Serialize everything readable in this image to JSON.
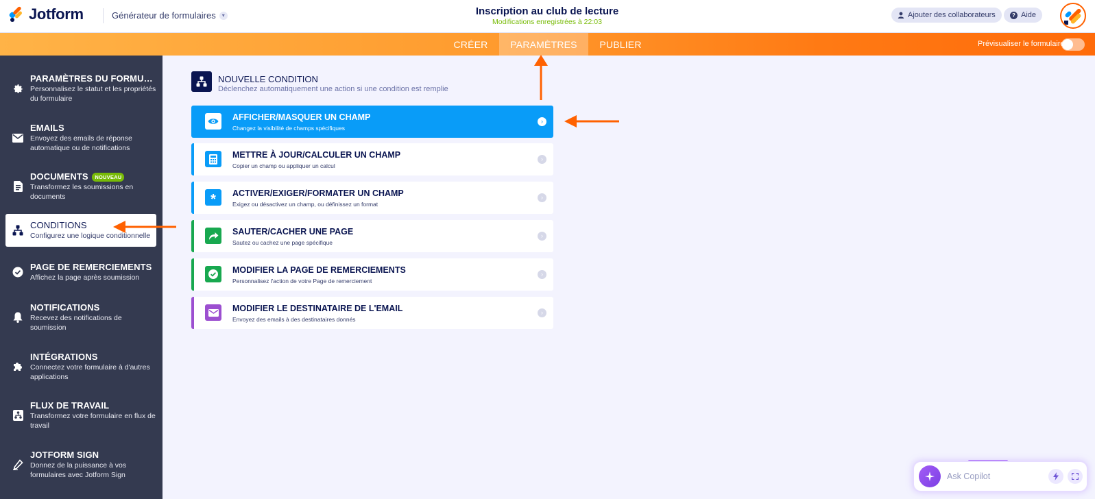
{
  "header": {
    "logo_text": "Jotform",
    "builder_label": "Générateur de formulaires",
    "form_title": "Inscription au club de lecture",
    "saved_status": "Modifications enregistrées à 22:03",
    "collaborators_label": "Ajouter des collaborateurs",
    "help_label": "Aide"
  },
  "navbar": {
    "tabs": [
      {
        "label": "CRÉER",
        "active": false
      },
      {
        "label": "PARAMÈTRES",
        "active": true
      },
      {
        "label": "PUBLIER",
        "active": false
      }
    ],
    "preview_label": "Prévisualiser le formulaire",
    "preview_enabled": false
  },
  "sidebar": {
    "items": [
      {
        "title": "PARAMÈTRES DU FORMULAIRE",
        "desc": "Personnalisez le statut et les propriétés du formulaire",
        "icon": "gear-icon"
      },
      {
        "title": "EMAILS",
        "desc": "Envoyez des emails de réponse automatique ou de notifications",
        "icon": "envelope-icon"
      },
      {
        "title": "DOCUMENTS",
        "badge": "NOUVEAU",
        "desc": "Transformez les soumissions en documents",
        "icon": "document-icon"
      },
      {
        "title": "CONDITIONS",
        "desc": "Configurez une logique conditionnelle",
        "icon": "hierarchy-icon",
        "active": true
      },
      {
        "title": "PAGE DE REMERCIEMENTS",
        "desc": "Affichez la page après soumission",
        "icon": "check-circle-icon"
      },
      {
        "title": "NOTIFICATIONS",
        "desc": "Recevez des notifications de soumission",
        "icon": "bell-icon"
      },
      {
        "title": "INTÉGRATIONS",
        "desc": "Connectez votre formulaire à d'autres applications",
        "icon": "puzzle-icon"
      },
      {
        "title": "FLUX DE TRAVAIL",
        "desc": "Transformez votre formulaire en flux de travail",
        "icon": "workflow-icon"
      },
      {
        "title": "JOTFORM SIGN",
        "desc": "Donnez de la puissance à vos formulaires avec Jotform Sign",
        "icon": "pen-icon"
      }
    ]
  },
  "condition": {
    "title": "NOUVELLE CONDITION",
    "desc": "Déclenchez automatiquement une action si une condition est remplie",
    "options": [
      {
        "title": "AFFICHER/MASQUER UN CHAMP",
        "desc": "Changez la visibilité de champs spécifiques",
        "icon": "eye-icon",
        "color": "#099cf8",
        "selected": true
      },
      {
        "title": "METTRE À JOUR/CALCULER UN CHAMP",
        "desc": "Copier un champ ou appliquer un calcul",
        "icon": "calculator-icon",
        "color": "#099cf8"
      },
      {
        "title": "ACTIVER/EXIGER/FORMATER UN CHAMP",
        "desc": "Exigez ou désactivez un champ, ou définissez un format",
        "icon": "asterisk-icon",
        "color": "#099cf8"
      },
      {
        "title": "SAUTER/CACHER UNE PAGE",
        "desc": "Sautez ou cachez une page spécifique",
        "icon": "forward-arrow-icon",
        "color": "#18a84f"
      },
      {
        "title": "MODIFIER LA PAGE DE REMERCIEMENTS",
        "desc": "Personnalisez l'action de votre Page de remerciement",
        "icon": "check-icon",
        "color": "#18a84f"
      },
      {
        "title": "MODIFIER LE DESTINATAIRE DE L'EMAIL",
        "desc": "Envoyez des emails à des destinataires donnés",
        "icon": "mail-icon",
        "color": "#9c4fd0"
      }
    ]
  },
  "copilot": {
    "placeholder": "Ask Copilot"
  },
  "colors": {
    "accent_orange": "#ff6100",
    "sidebar_bg": "#343a50",
    "selected_blue": "#099cf8",
    "saved_green": "#78bb07"
  }
}
